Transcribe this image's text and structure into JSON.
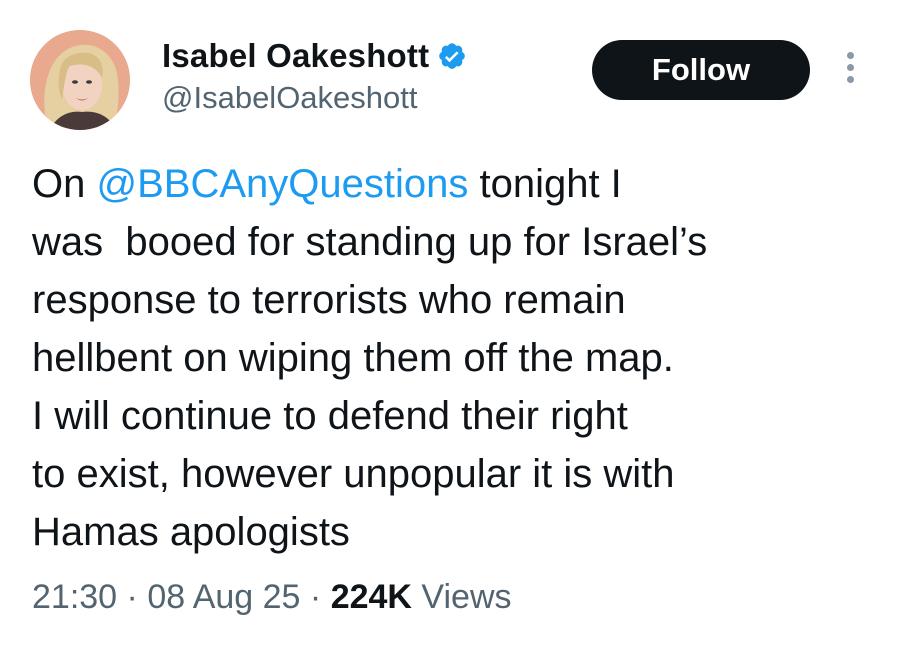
{
  "author": {
    "display_name": "Isabel Oakeshott",
    "handle": "@IsabelOakeshott",
    "verified": true
  },
  "actions": {
    "follow_label": "Follow",
    "more_icon": "more-vertical-icon"
  },
  "tweet": {
    "line_1_prefix": "On ",
    "mention": "@BBCAnyQuestions",
    "line_1_suffix": " tonight I",
    "body_rest": "was  booed for standing up for Israel’s\nresponse to terrorists who remain\nhellbent on wiping them off the map.\nI will continue to defend their right\nto exist, however unpopular it is with\nHamas apologists"
  },
  "meta": {
    "time": "21:30",
    "separator": " · ",
    "date": "08 Aug 25",
    "views_count": "224K",
    "views_label": " Views"
  },
  "colors": {
    "link": "#1d9bf0",
    "text": "#0f1419",
    "secondary": "#536471",
    "verified": "#1d9bf0",
    "button_bg": "#0f1419"
  }
}
